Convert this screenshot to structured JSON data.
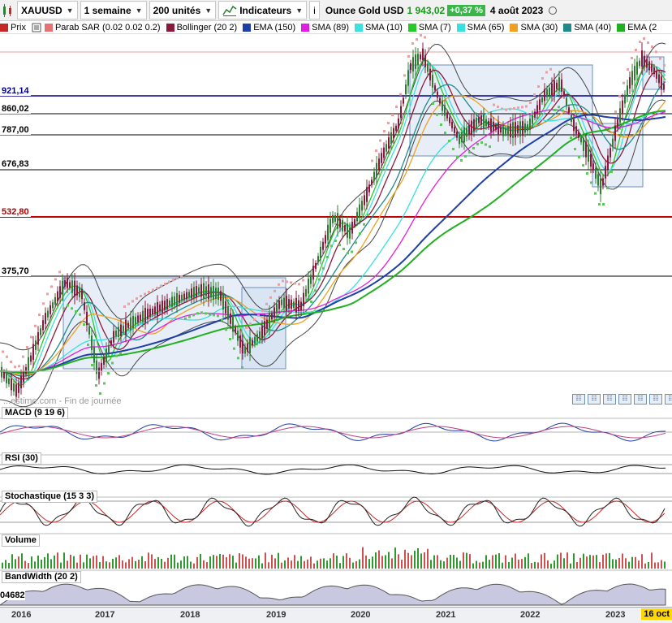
{
  "toolbar": {
    "symbol": "XAUUSD",
    "period": "1 semaine",
    "units": "200 unités",
    "indicators_label": "Indicateurs",
    "info_icon": "i",
    "quote_name": "Ounce Gold USD",
    "quote_price": "1 943,02",
    "quote_change": "+0,37 %",
    "quote_date": "4 août 2023"
  },
  "legend": [
    {
      "label": "Prix",
      "color": "#c62828"
    },
    {
      "label": "Parab SAR (0.02 0.02 0.2)",
      "color": "#e57373"
    },
    {
      "label": "Bollinger (20 2)",
      "color": "#8b1a3a"
    },
    {
      "label": "EMA (150)",
      "color": "#1f3fa8"
    },
    {
      "label": "SMA (89)",
      "color": "#e020e0"
    },
    {
      "label": "SMA (10)",
      "color": "#3fe0e0"
    },
    {
      "label": "SMA (7)",
      "color": "#28c828"
    },
    {
      "label": "SMA (65)",
      "color": "#38e0e0"
    },
    {
      "label": "SMA (30)",
      "color": "#f0a020"
    },
    {
      "label": "SMA (40)",
      "color": "#1e8a8a"
    },
    {
      "label": "EMA (2",
      "color": "#20b020"
    }
  ],
  "price_levels": [
    {
      "label": "921,14",
      "color": "#00008b"
    },
    {
      "label": "860,02",
      "color": "#000000"
    },
    {
      "label": "787,00",
      "color": "#000000"
    },
    {
      "label": "676,83",
      "color": "#000000"
    },
    {
      "label": "532,80",
      "color": "#b00000"
    },
    {
      "label": "375,70",
      "color": "#000000"
    }
  ],
  "watermark": "...estime.com - Fin de journée",
  "panes": {
    "macd": "MACD (9 19 6)",
    "rsi": "RSI (30)",
    "stoch": "Stochastique (15 3 3)",
    "volume": "Volume",
    "bandwidth": "BandWidth (20 2)",
    "bandwidth_value": "04682"
  },
  "x_axis": [
    "2016",
    "2017",
    "2018",
    "2019",
    "2020",
    "2021",
    "2022",
    "2023"
  ],
  "current_date": "16 oct",
  "colors": {
    "candle_up": "#2e7d32",
    "candle_down": "#8b1a3a",
    "box": "#c9d9ef",
    "sar": "#e8a0a0",
    "volume_up": "#2e9a2e",
    "volume_down": "#d05050",
    "bandwidth_fill": "#c8c8e0"
  }
}
